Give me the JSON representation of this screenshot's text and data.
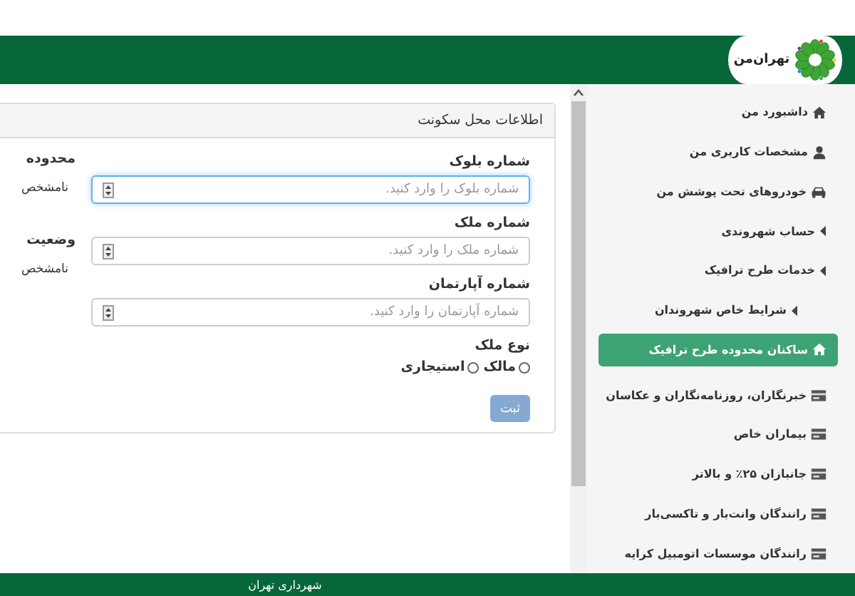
{
  "header": {
    "logo_text": "تهران‌من"
  },
  "panel": {
    "title": "اطلاعات محل سکونت",
    "fields": [
      {
        "label": "شماره بلوک",
        "placeholder": "شماره بلوک را وارد کنید.",
        "focused": true
      },
      {
        "label": "شماره ملک",
        "placeholder": "شماره ملک را وارد کنید.",
        "focused": false
      },
      {
        "label": "شماره آپارتمان",
        "placeholder": "شماره آپارتمان را وارد کنید.",
        "focused": false
      }
    ],
    "radio_group": {
      "label": "نوع ملک",
      "options": [
        {
          "label": "مالک",
          "selected": false
        },
        {
          "label": "استیجاری",
          "selected": false
        }
      ]
    },
    "submit": "ثبت",
    "info": [
      {
        "label": "محدوده",
        "value": "نامشخص"
      },
      {
        "label": "وضعیت",
        "value": "نامشخص"
      }
    ]
  },
  "sidebar": {
    "items": [
      {
        "label": "داشبورد من",
        "kind": "home",
        "selected": false
      },
      {
        "label": "مشخصات کاربری من",
        "kind": "user",
        "selected": false
      },
      {
        "label": "خودروهای تحت پوشش من",
        "kind": "car",
        "selected": false
      },
      {
        "label": "حساب شهروندی",
        "kind": "caret",
        "selected": false
      },
      {
        "label": "خدمات طرح ترافیک",
        "kind": "caret",
        "selected": false,
        "children": [
          {
            "label": "شرایط خاص شهروندان",
            "kind": "caret",
            "selected": false
          }
        ]
      },
      {
        "label": "ساکنان محدوده طرح ترافیک",
        "kind": "home",
        "selected": true
      },
      {
        "label": "خبرنگاران، روزنامه‌نگاران و عکاسان",
        "kind": "card",
        "selected": false
      },
      {
        "label": "بیماران خاص",
        "kind": "card",
        "selected": false
      },
      {
        "label": "جانبازان ۲۵٪ و بالاتر",
        "kind": "card",
        "selected": false
      },
      {
        "label": "رانندگان وانت‌بار و تاکسی‌بار",
        "kind": "card",
        "selected": false
      },
      {
        "label": "رانندگان موسسات اتومبیل کرایه",
        "kind": "card",
        "selected": false
      }
    ]
  },
  "footer": {
    "text": "شهرداری تهران"
  }
}
